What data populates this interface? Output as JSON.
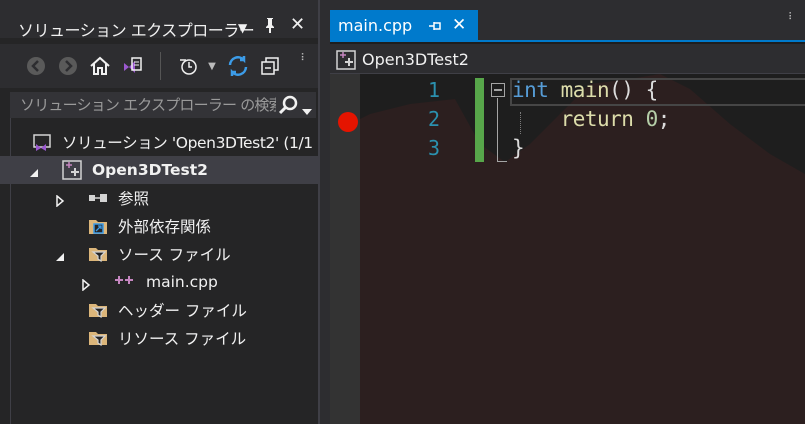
{
  "solution_explorer": {
    "title": "ソリューション エクスプローラー",
    "search_placeholder": "ソリューション エクスプローラー の検索",
    "tree": [
      {
        "label": "ソリューション 'Open3DTest2' (1/1 ",
        "icon": "solution-icon"
      },
      {
        "label": "Open3DTest2",
        "icon": "cpp-project-icon"
      },
      {
        "label": "参照",
        "icon": "references-icon"
      },
      {
        "label": "外部依存関係",
        "icon": "external-dependencies-icon"
      },
      {
        "label": "ソース ファイル",
        "icon": "filter-folder-icon"
      },
      {
        "label": "main.cpp",
        "icon": "cpp-file-icon"
      },
      {
        "label": "ヘッダー ファイル",
        "icon": "filter-folder-icon"
      },
      {
        "label": "リソース ファイル",
        "icon": "filter-folder-icon"
      }
    ]
  },
  "editor": {
    "tab": {
      "label": "main.cpp"
    },
    "nav_project": "Open3DTest2",
    "line_numbers": [
      "1",
      "2",
      "3"
    ],
    "code": {
      "line1_kw": "int",
      "line1_fn": "main",
      "line1_rest": "() {",
      "line2_kw": "return",
      "line2_num": "0",
      "line2_end": ";",
      "line3": "}"
    }
  },
  "colors": {
    "accent": "#007acc",
    "breakpoint": "#e51400",
    "keyword": "#569cd6",
    "function": "#dcdcaa",
    "number": "#b5cea8",
    "line_number": "#2b91af",
    "change_bar": "#57a64a"
  }
}
